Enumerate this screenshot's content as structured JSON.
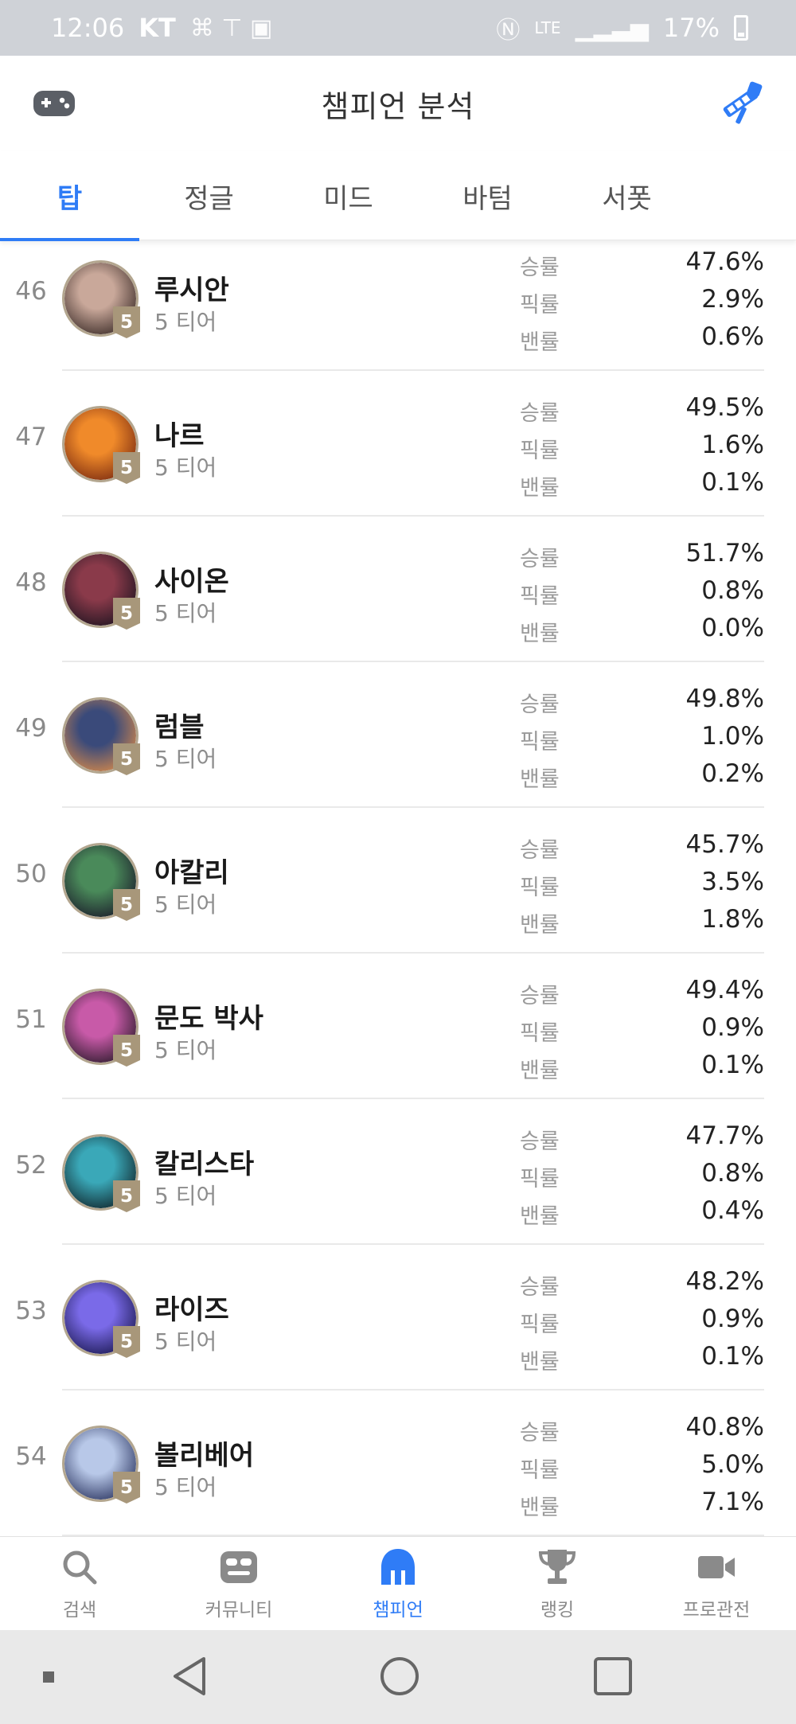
{
  "status_bar": {
    "time": "12:06",
    "carrier": "KT",
    "network": "LTE",
    "battery": "17%"
  },
  "header": {
    "title": "챔피언 분석"
  },
  "tabs": [
    {
      "label": "탑",
      "active": true
    },
    {
      "label": "정글",
      "active": false
    },
    {
      "label": "미드",
      "active": false
    },
    {
      "label": "바텀",
      "active": false
    },
    {
      "label": "서폿",
      "active": false
    }
  ],
  "stat_labels": {
    "win": "승률",
    "pick": "픽률",
    "ban": "밴률"
  },
  "champions": [
    {
      "rank": "46",
      "name": "루시안",
      "tier_badge": "5",
      "tier_text": "5 티어",
      "win": "47.6%",
      "pick": "2.9%",
      "ban": "0.6%",
      "colors": [
        "#c9a89a",
        "#3a2a26"
      ]
    },
    {
      "rank": "47",
      "name": "나르",
      "tier_badge": "5",
      "tier_text": "5 티어",
      "win": "49.5%",
      "pick": "1.6%",
      "ban": "0.1%",
      "colors": [
        "#f08a2a",
        "#7a2a10"
      ]
    },
    {
      "rank": "48",
      "name": "사이온",
      "tier_badge": "5",
      "tier_text": "5 티어",
      "win": "51.7%",
      "pick": "0.8%",
      "ban": "0.0%",
      "colors": [
        "#8a3a4a",
        "#1e1420"
      ]
    },
    {
      "rank": "49",
      "name": "럼블",
      "tier_badge": "5",
      "tier_text": "5 티어",
      "win": "49.8%",
      "pick": "1.0%",
      "ban": "0.2%",
      "colors": [
        "#3a4a7a",
        "#d88a4a"
      ]
    },
    {
      "rank": "50",
      "name": "아칼리",
      "tier_badge": "5",
      "tier_text": "5 티어",
      "win": "45.7%",
      "pick": "3.5%",
      "ban": "1.8%",
      "colors": [
        "#4a8a5a",
        "#1a1a2a"
      ]
    },
    {
      "rank": "51",
      "name": "문도 박사",
      "tier_badge": "5",
      "tier_text": "5 티어",
      "win": "49.4%",
      "pick": "0.9%",
      "ban": "0.1%",
      "colors": [
        "#c85aa8",
        "#2a1a2a"
      ]
    },
    {
      "rank": "52",
      "name": "칼리스타",
      "tier_badge": "5",
      "tier_text": "5 티어",
      "win": "47.7%",
      "pick": "0.8%",
      "ban": "0.4%",
      "colors": [
        "#3aa8b8",
        "#10242a"
      ]
    },
    {
      "rank": "53",
      "name": "라이즈",
      "tier_badge": "5",
      "tier_text": "5 티어",
      "win": "48.2%",
      "pick": "0.9%",
      "ban": "0.1%",
      "colors": [
        "#7a6ae8",
        "#1a1850"
      ]
    },
    {
      "rank": "54",
      "name": "볼리베어",
      "tier_badge": "5",
      "tier_text": "5 티어",
      "win": "40.8%",
      "pick": "5.0%",
      "ban": "7.1%",
      "colors": [
        "#b8c8e8",
        "#2a3460"
      ]
    }
  ],
  "bottom_nav": [
    {
      "label": "검색",
      "icon": "search-icon",
      "active": false
    },
    {
      "label": "커뮤니티",
      "icon": "community-icon",
      "active": false
    },
    {
      "label": "챔피언",
      "icon": "champion-icon",
      "active": true
    },
    {
      "label": "랭킹",
      "icon": "trophy-icon",
      "active": false
    },
    {
      "label": "프로관전",
      "icon": "video-camera-icon",
      "active": false
    }
  ],
  "colors": {
    "accent": "#2f7cf6",
    "tier_badge": "#a8977a"
  }
}
